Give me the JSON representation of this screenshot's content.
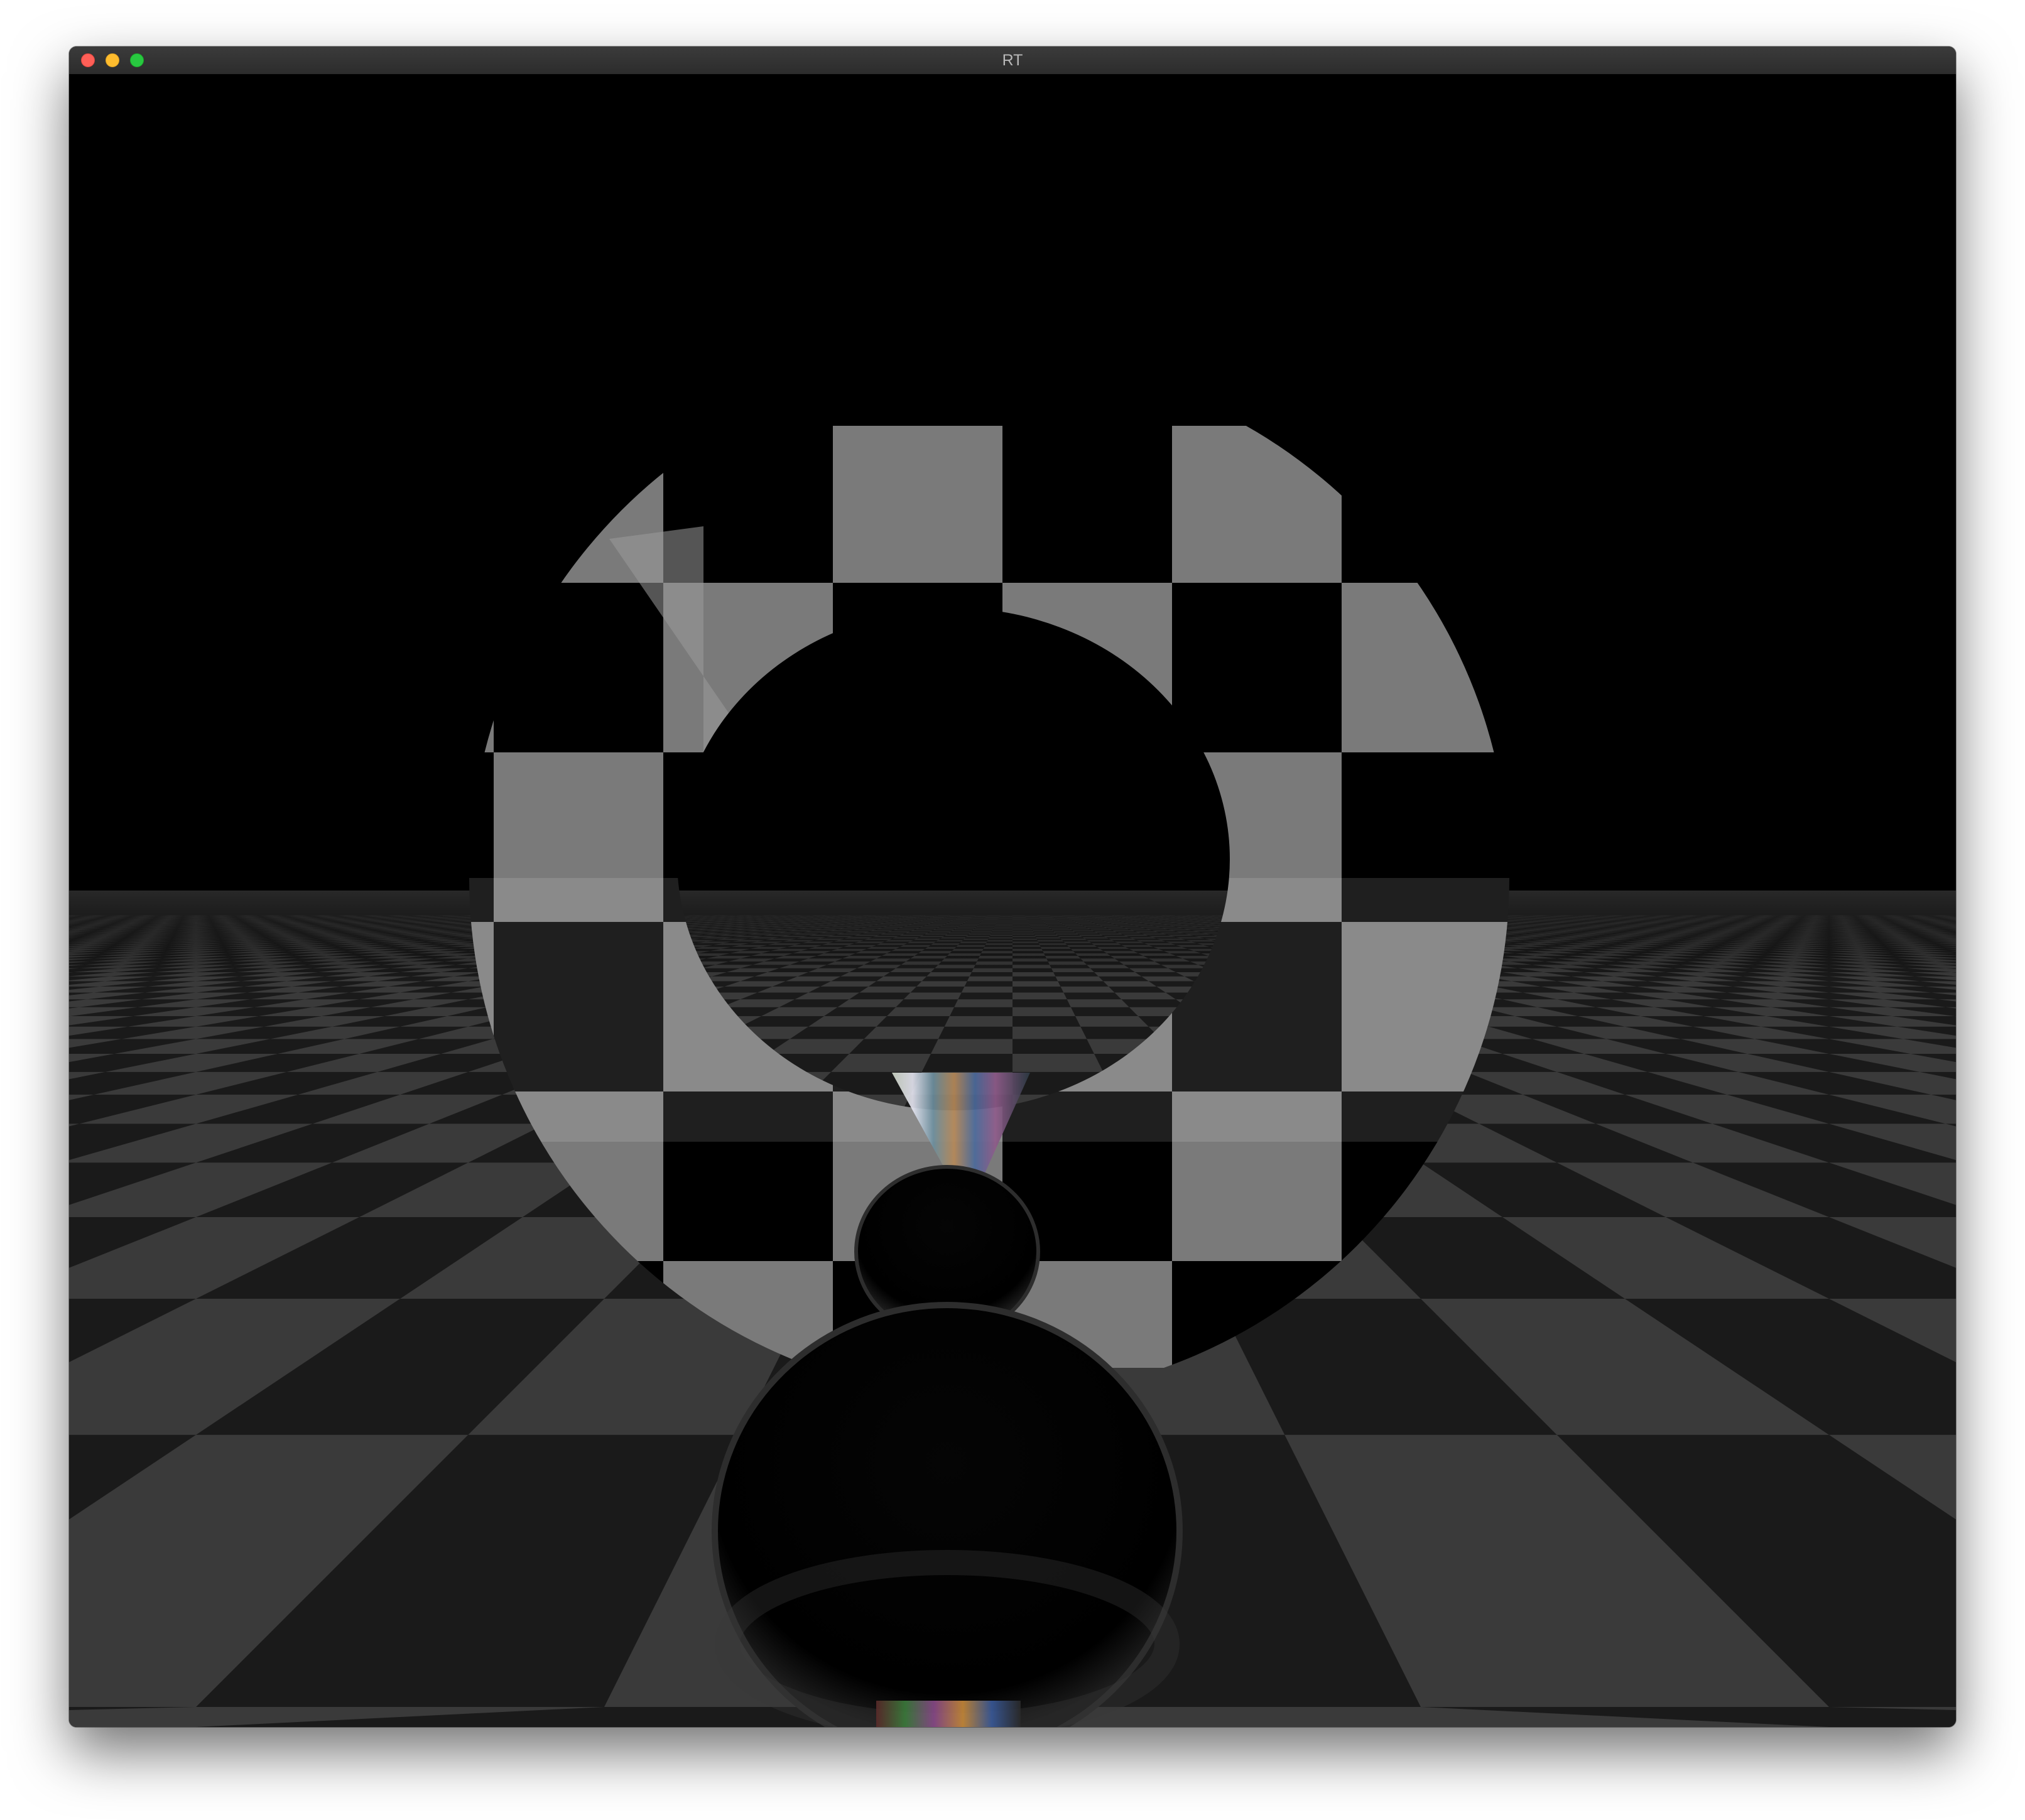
{
  "window": {
    "title": "RT",
    "controls": {
      "close": "close-button",
      "minimize": "minimize-button",
      "zoom": "zoom-button"
    }
  },
  "scene": {
    "description_colors": {
      "background": "#000000",
      "floor_light": "#3a3a3a",
      "floor_dark": "#000000",
      "torus_light": "#7a7a7a",
      "sphere": "#000000"
    }
  }
}
